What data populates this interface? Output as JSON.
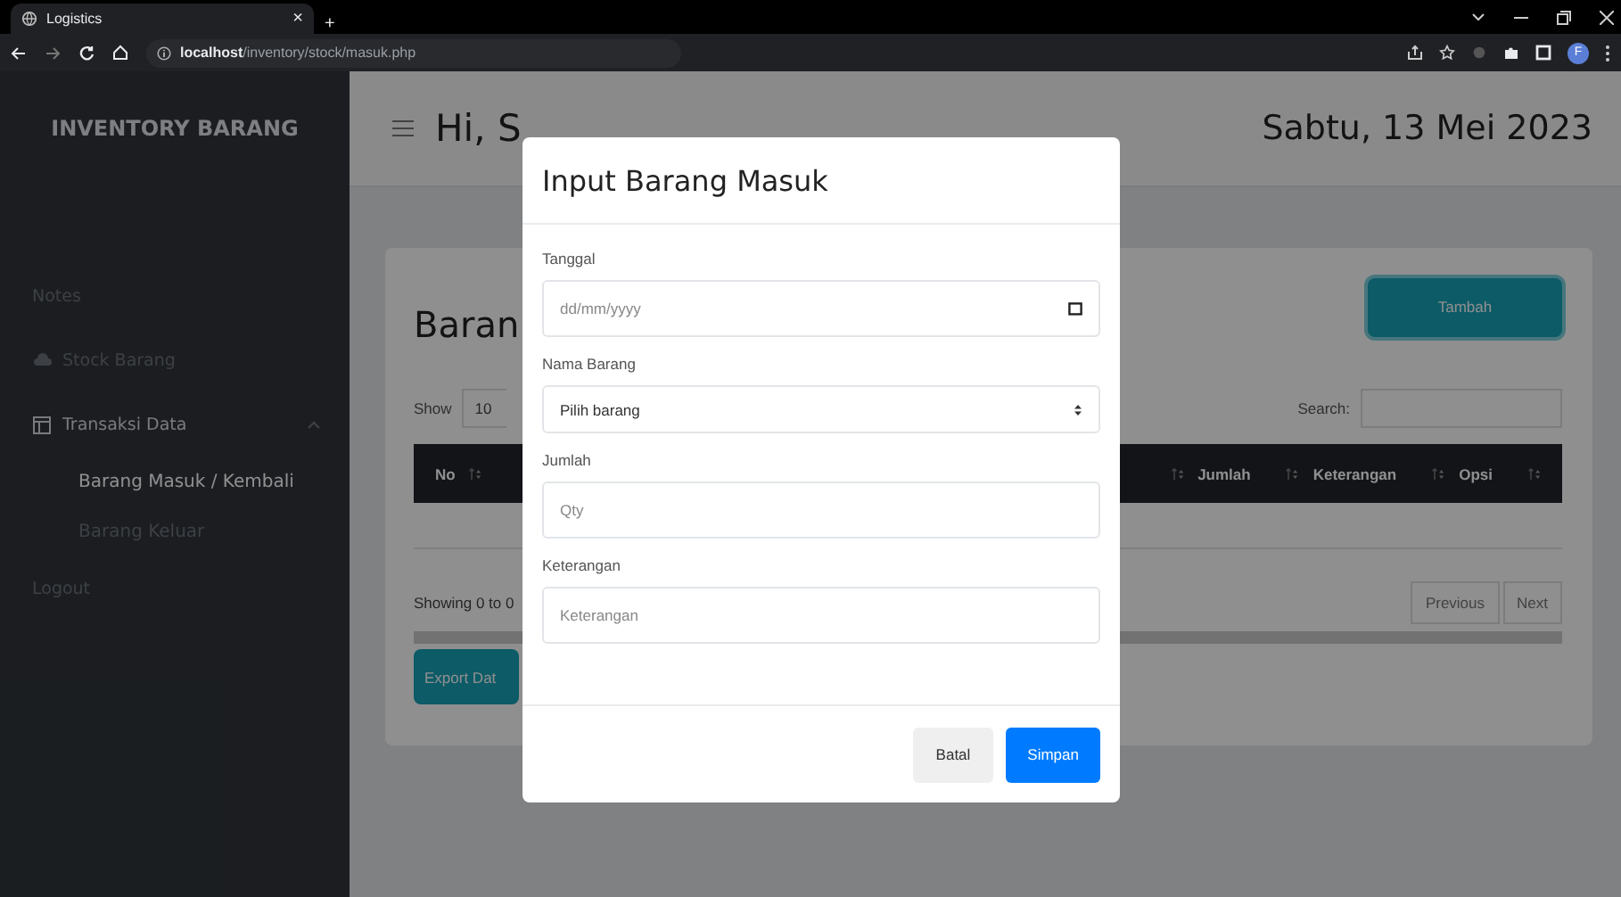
{
  "browser": {
    "tab_title": "Logistics",
    "tab_close": "×",
    "new_tab": "+",
    "url_host": "localhost",
    "url_path": "/inventory/stock/masuk.php",
    "profile": "F"
  },
  "sidebar": {
    "brand": "INVENTORY BARANG",
    "items": [
      {
        "label": "Notes",
        "selected": false
      },
      {
        "label": "Stock Barang",
        "selected": false
      },
      {
        "label": "Transaksi Data",
        "selected": false,
        "expanded": true,
        "children": [
          {
            "label": "Barang Masuk / Kembali",
            "selected": true
          },
          {
            "label": "Barang Keluar",
            "selected": false
          }
        ]
      },
      {
        "label": "Logout",
        "selected": false
      }
    ]
  },
  "header": {
    "greeting": "Hi, S",
    "date": "Sabtu, 13 Mei 2023"
  },
  "card": {
    "title": "Baran",
    "add_button": "Tambah",
    "show_label": "Show",
    "show_value": "10",
    "search_label": "Search:",
    "columns": [
      "No",
      "Jumlah",
      "Keterangan",
      "Opsi"
    ],
    "info": "Showing 0 to 0",
    "pagination": [
      "Previous",
      "Next"
    ],
    "export_button": "Export Dat"
  },
  "modal": {
    "title": "Input Barang Masuk",
    "fields": [
      {
        "kind": "date",
        "label": "Tanggal",
        "placeholder": "dd/mm/yyyy"
      },
      {
        "kind": "select",
        "label": "Nama Barang",
        "value": "Pilih barang"
      },
      {
        "kind": "text",
        "label": "Jumlah",
        "placeholder": "Qty"
      },
      {
        "kind": "text",
        "label": "Keterangan",
        "placeholder": "Keterangan"
      }
    ],
    "buttons": [
      {
        "label": "Batal",
        "kind": "secondary"
      },
      {
        "label": "Simpan",
        "kind": "primary"
      }
    ]
  }
}
